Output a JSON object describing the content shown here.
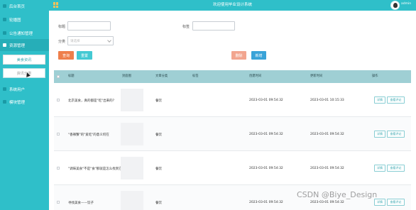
{
  "sidebar": {
    "items": [
      {
        "label": "后台首页"
      },
      {
        "label": "轮播图"
      },
      {
        "label": "公告通知管理"
      },
      {
        "label": "资源管理"
      },
      {
        "label": "系统用户"
      },
      {
        "label": "模块管理"
      }
    ],
    "sub_items": [
      {
        "label": "美食资讯"
      },
      {
        "label": "资讯分类"
      }
    ]
  },
  "topbar": {
    "title": "欢迎使用毕业设计系统",
    "user": "admin"
  },
  "filters": {
    "title_label": "标题",
    "title2_label": "标签",
    "category_label": "分类",
    "category_placeholder": "请选择"
  },
  "toolbar": {
    "query_label": "查询",
    "reset_label": "重置",
    "delete_label": "删除",
    "add_label": "新增"
  },
  "table": {
    "headers": [
      "标题",
      "封面图",
      "文章分类",
      "标签",
      "创建时间",
      "更新时间",
      "操作"
    ],
    "rows": [
      {
        "title": "北京美食，真的都是\"吃\"出来的？",
        "category": "餐饮",
        "tags": "",
        "created": "2023-03-01 09:54:32",
        "updated": "2023-03-01 10:15:33"
      },
      {
        "title": "\"香辣蟹\"的\"爱吃\"的意义何在",
        "category": "餐饮",
        "tags": "",
        "created": "2023-03-01 09:54:32",
        "updated": "2023-03-01 09:54:32"
      },
      {
        "title": "\"调味美食\"不是\"食\"那就是怎么找到它",
        "category": "餐饮",
        "tags": "",
        "created": "2023-03-01 09:54:32",
        "updated": "2023-03-01 09:54:32"
      },
      {
        "title": "寻找美食——饺子",
        "category": "餐饮",
        "tags": "",
        "created": "2023-03-01 09:54:32",
        "updated": "2023-03-01 09:54:32"
      }
    ],
    "op_edit": "详情",
    "op_more": "查看评论"
  },
  "watermark": "CSDN @Biye_Design",
  "colors": {
    "accent": "#2fbfc9",
    "query_button": "#ee7f4b",
    "reset_button": "#44c9d3",
    "delete_button": "#f2a58f",
    "add_button": "#3aa3d8"
  }
}
